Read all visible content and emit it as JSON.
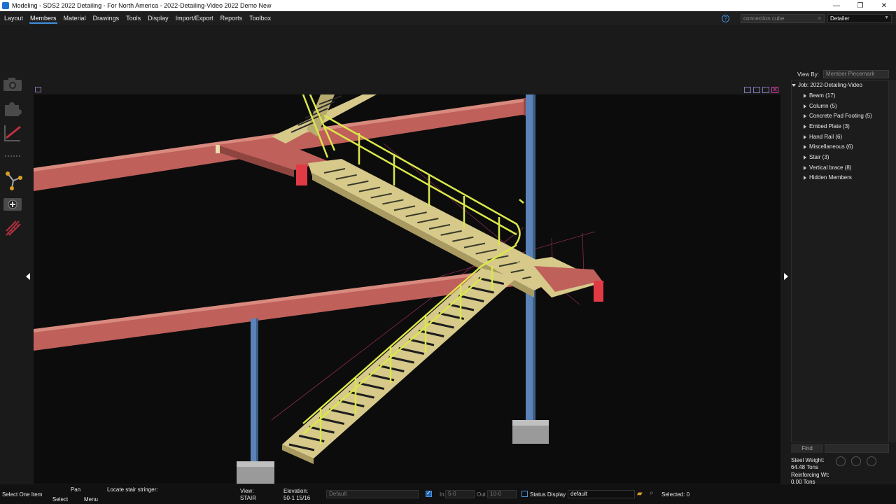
{
  "titlebar": {
    "title": "Modeling - SDS2 2022 Detailing - For North America - 2022-Detailing-Video 2022 Demo New",
    "minimize": "—",
    "restore": "❐",
    "close": "✕"
  },
  "menubar": {
    "items": [
      "Layout",
      "Members",
      "Material",
      "Drawings",
      "Tools",
      "Display",
      "Import/Export",
      "Reports",
      "Toolbox"
    ],
    "active": "Members",
    "help": "?",
    "search_value": "connection cube",
    "search_clear": "×",
    "role_value": "Detailer"
  },
  "left_toolbar": {
    "icons": [
      "camera-icon",
      "puzzle-icon",
      "pencil-draw-icon",
      "dotted-line-icon",
      "node-graph-icon",
      "add-camera-icon",
      "stair-rail-icon"
    ]
  },
  "colors": {
    "beam": "#c0605a",
    "column": "#5b83b8",
    "stair": "#d6c98a",
    "rail": "#d9e84a",
    "cut_face": "#e03a45",
    "footing": "#a8a8a8"
  },
  "right_panel": {
    "view_by_label": "View By:",
    "view_by_value": "Member Piecemark",
    "job_label": "Job: 2022-Detailing-Video",
    "tree_items": [
      "Beam (17)",
      "Column (5)",
      "Concrete Pad Footing (5)",
      "Embed Plate (3)",
      "Hand Rail (6)",
      "Miscellaneous (6)",
      "Stair (3)",
      "Vertical brace (8)",
      "Hidden Members"
    ],
    "find_label": "Find",
    "steel_weight_label": "Steel Weight:",
    "steel_weight_value": "64.48 Tons",
    "reinforcing_label": "Reinforcing Wt:",
    "reinforcing_value": "0.00 Tons"
  },
  "statusbar": {
    "select_one_item": "Select One Item",
    "pan": "Pan",
    "select": "Select",
    "menu": "Menu",
    "prompt": "Locate stair stringer:",
    "view_label": "View:",
    "view_value": "STAIR",
    "elevation_label": "Elevation:",
    "elevation_value": "50-1 15/16",
    "default_field": "Default",
    "in_label": "In",
    "in_value": "5-0",
    "out_label": "Out",
    "out_value": "10-0",
    "status_display_label": "Status Display",
    "status_display_value": "default",
    "selected": "Selected: 0"
  }
}
